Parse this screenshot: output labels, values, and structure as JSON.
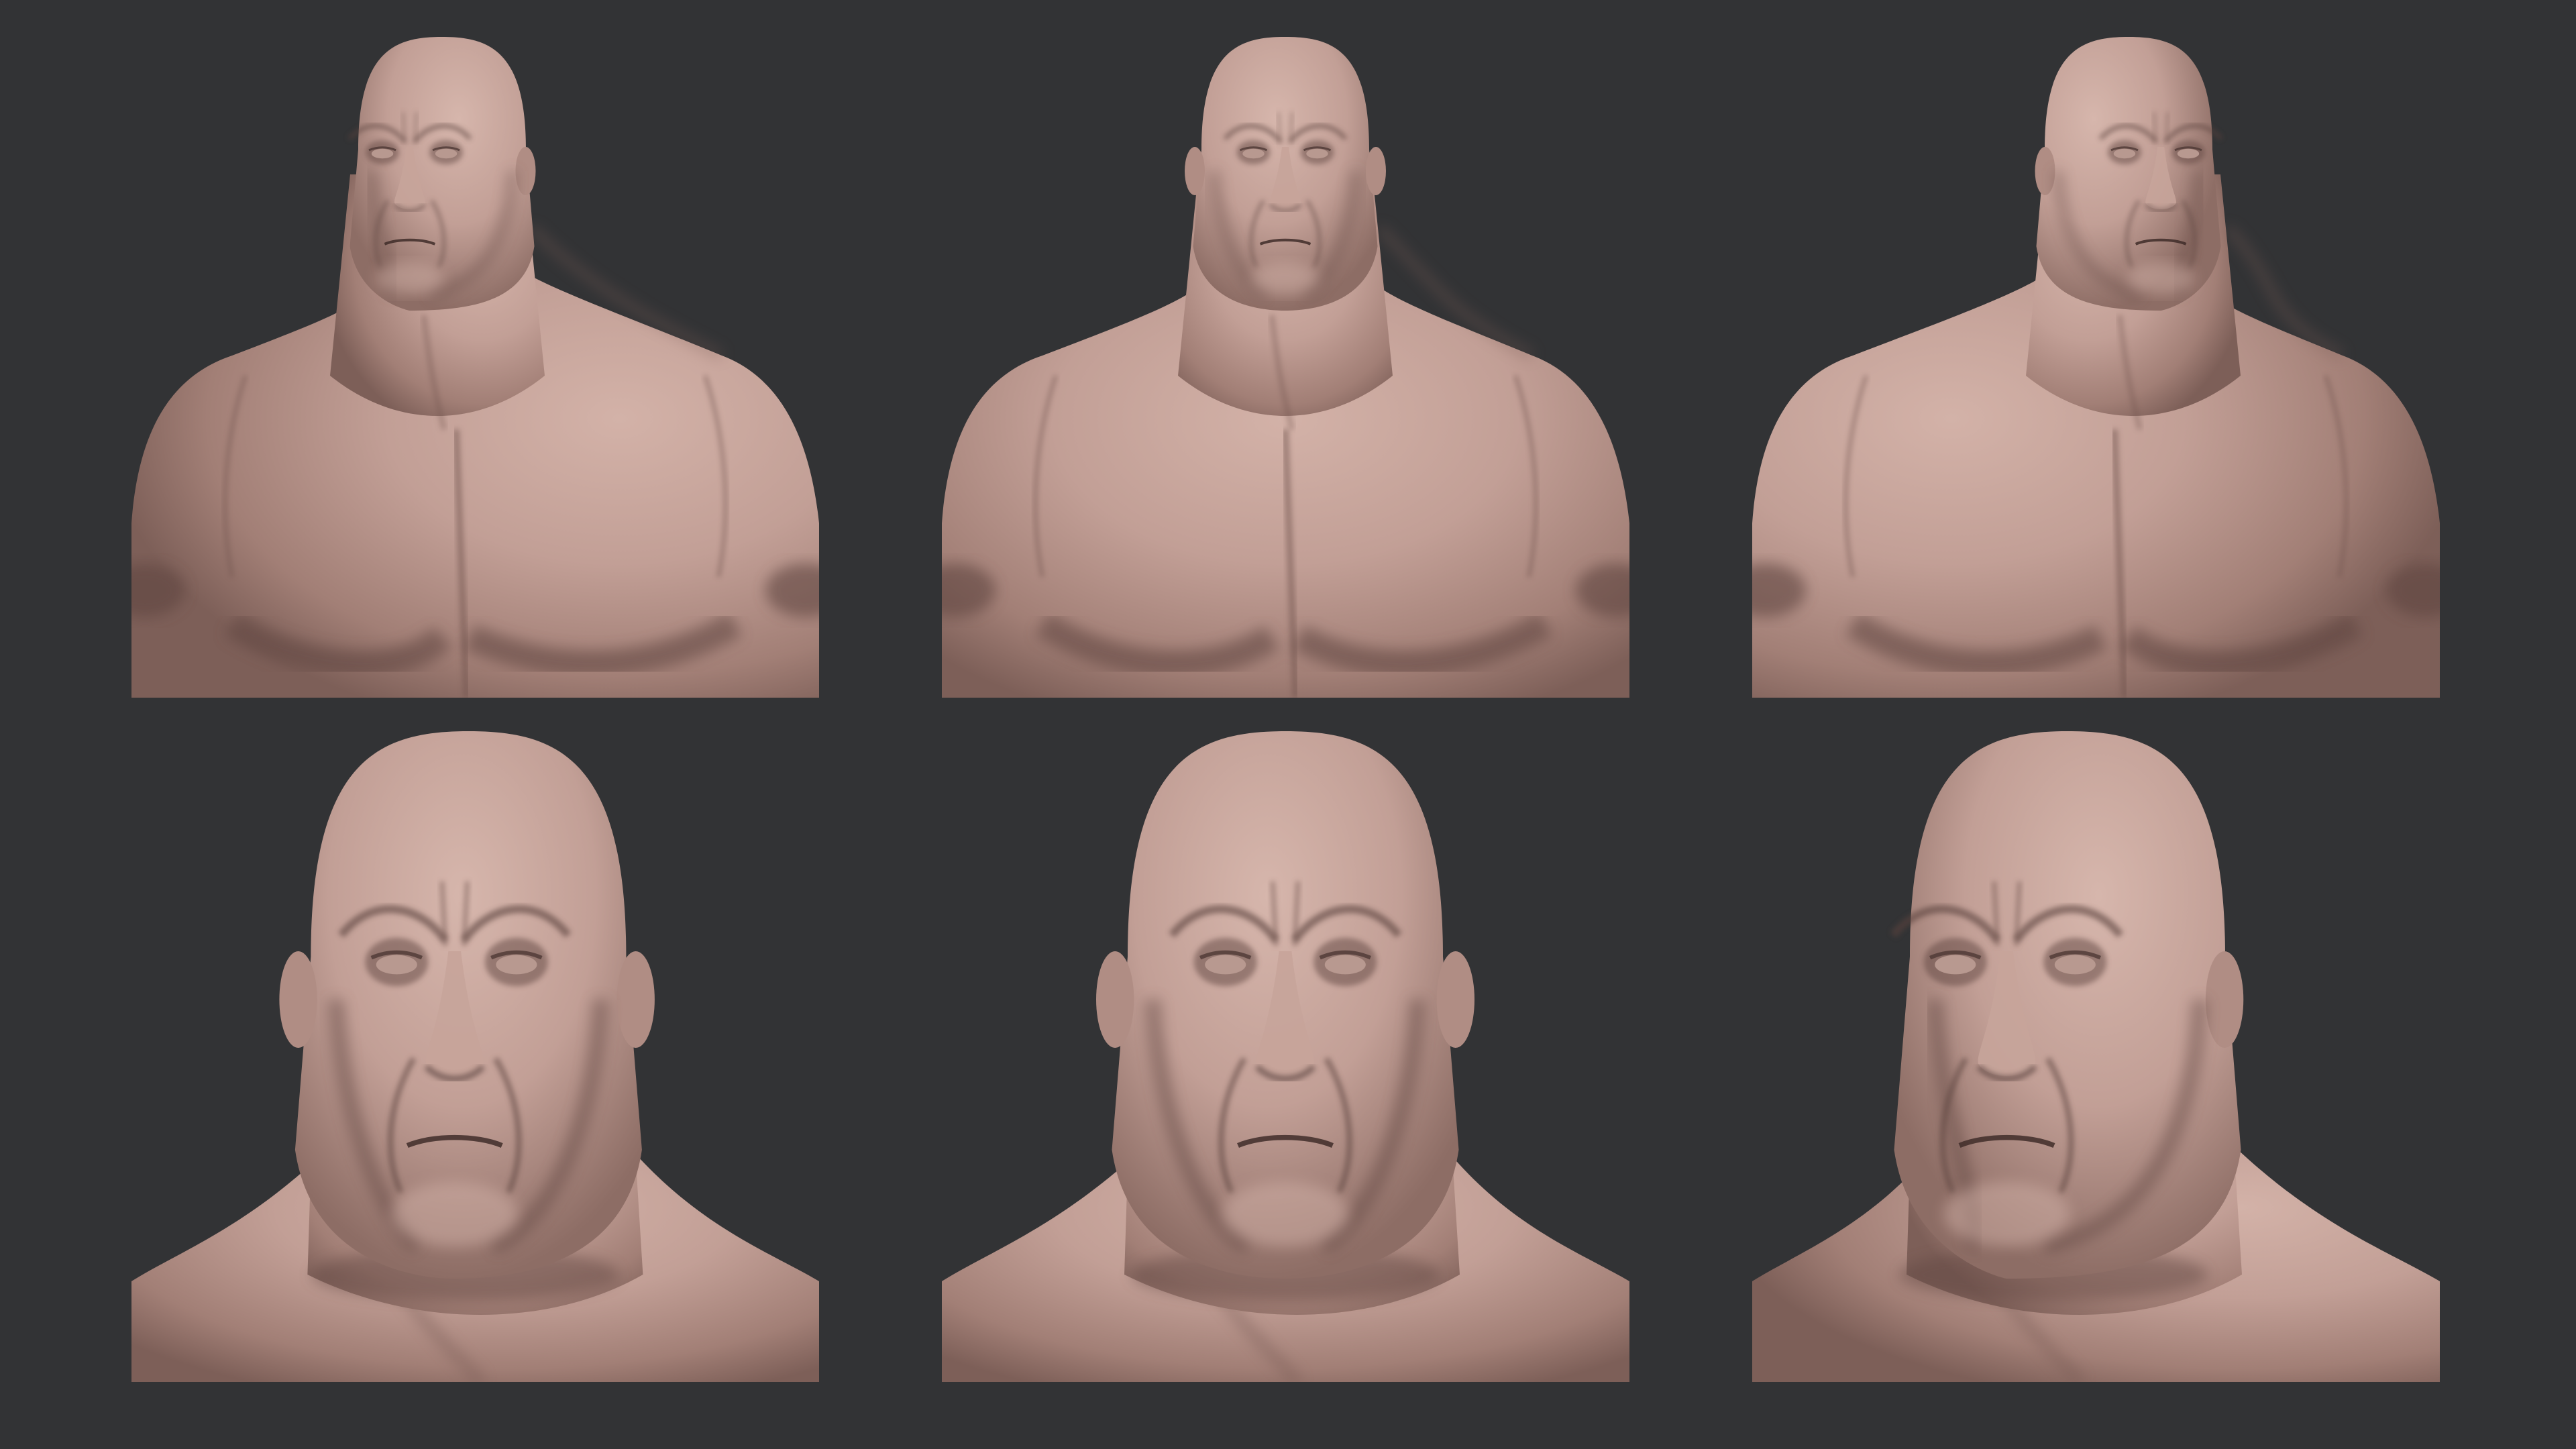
{
  "sheet": {
    "background": "#323335",
    "skin_light": "#c29f96",
    "skin_mid": "#a27f76",
    "skin_dark": "#5e4540",
    "panels": [
      {
        "name": "bust-three-quarter-left",
        "kind": "bust",
        "turn": -0.35
      },
      {
        "name": "bust-front",
        "kind": "bust",
        "turn": 0
      },
      {
        "name": "bust-three-quarter-right",
        "kind": "bust",
        "turn": 0.35
      },
      {
        "name": "head-front-left",
        "kind": "head",
        "turn": -0.08
      },
      {
        "name": "head-front",
        "kind": "head",
        "turn": 0
      },
      {
        "name": "head-three-quarter-left",
        "kind": "head",
        "turn": -0.35
      }
    ]
  }
}
